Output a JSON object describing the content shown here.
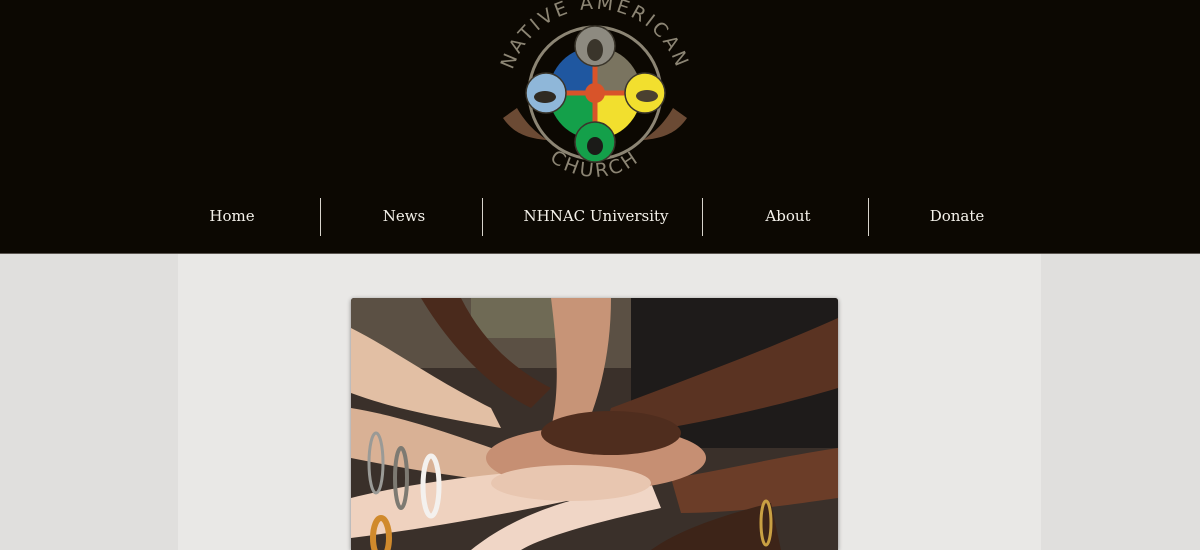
{
  "logo": {
    "top_text": "NATIVE AMERICAN",
    "bottom_text": "CHURCH",
    "colors": {
      "blue": "#1f57a0",
      "yellow": "#f2df2e",
      "green": "#14a04a",
      "red": "#d8542a",
      "ring": "#8c8574"
    }
  },
  "nav": {
    "items": [
      {
        "label": "Home"
      },
      {
        "label": "News"
      },
      {
        "label": "NHNAC University"
      },
      {
        "label": "About"
      },
      {
        "label": "Donate"
      }
    ]
  },
  "main": {
    "image_icon": "stacked-hands-photo"
  },
  "colors": {
    "header_bg": "#0c0802",
    "page_bg": "#e2e1df",
    "content_bg": "#e9e8e6",
    "nav_text": "#f4f1ea"
  }
}
